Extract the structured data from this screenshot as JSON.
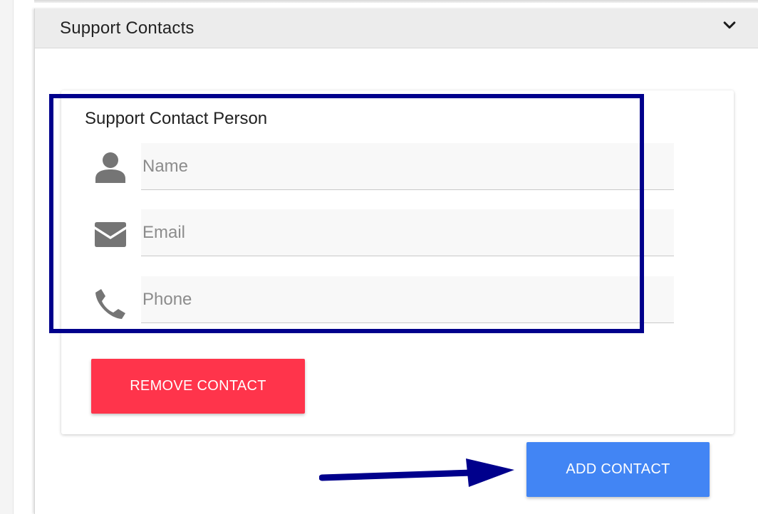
{
  "section": {
    "title": "Support Contacts",
    "toggle_icon": "chevron-down-icon"
  },
  "contact_card": {
    "title": "Support Contact Person",
    "fields": [
      {
        "icon": "user-icon",
        "placeholder": "Name",
        "value": ""
      },
      {
        "icon": "envelope-icon",
        "placeholder": "Email",
        "value": ""
      },
      {
        "icon": "phone-icon",
        "placeholder": "Phone",
        "value": ""
      }
    ],
    "remove_label": "REMOVE CONTACT"
  },
  "add_label": "ADD CONTACT",
  "annotations": {
    "highlight_color": "#00008c",
    "arrow_color": "#00008c"
  },
  "colors": {
    "remove_button": "#ff344b",
    "add_button": "#4285f4",
    "icon": "#757575"
  }
}
